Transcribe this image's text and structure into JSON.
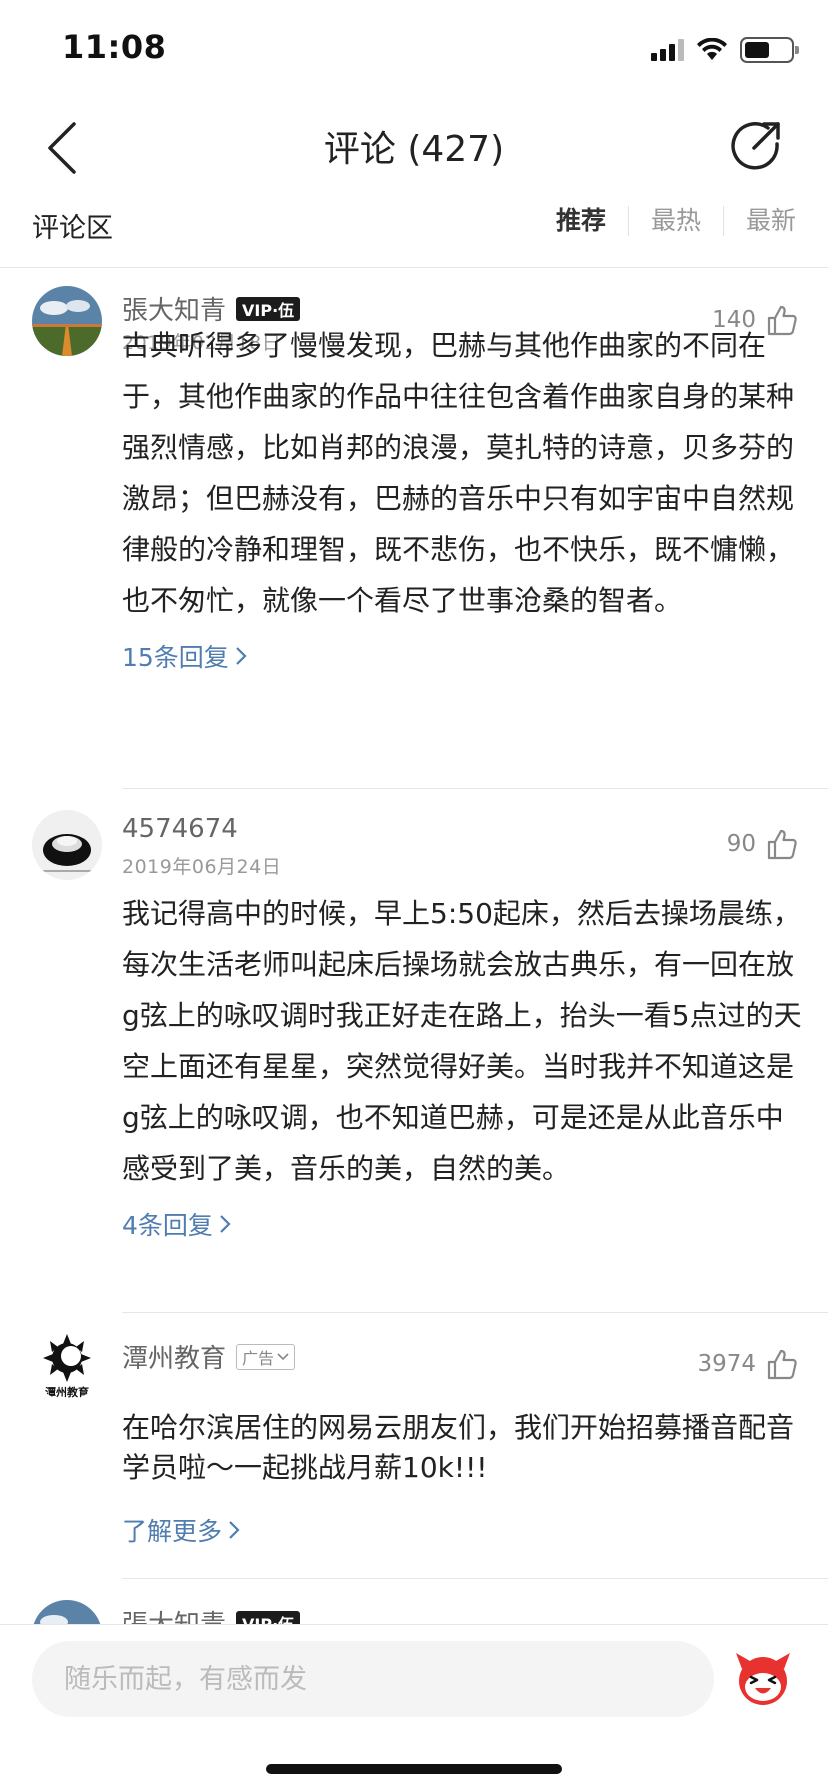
{
  "status_bar": {
    "time": "11:08"
  },
  "nav": {
    "title": "评论 (427)"
  },
  "section": {
    "title": "评论区",
    "sort_tabs": [
      {
        "label": "推荐",
        "active": true
      },
      {
        "label": "最热",
        "active": false
      },
      {
        "label": "最新",
        "active": false
      }
    ]
  },
  "comments": [
    {
      "username": "張大知青",
      "badge": "VIP·伍",
      "date": "2019年02月18日",
      "likes": "140",
      "content": "古典听得多了慢慢发现，巴赫与其他作曲家的不同在于，其他作曲家的作品中往往包含着作曲家自身的某种强烈情感，比如肖邦的浪漫，莫扎特的诗意，贝多芬的激昂；但巴赫没有，巴赫的音乐中只有如宇宙中自然规律般的冷静和理智，既不悲伤，也不快乐，既不慵懒，也不匆忙，就像一个看尽了世事沧桑的智者。",
      "replies": "15条回复"
    },
    {
      "username": "4574674",
      "date": "2019年06月24日",
      "likes": "90",
      "content": "我记得高中的时候，早上5:50起床，然后去操场晨练，每次生活老师叫起床后操场就会放古典乐，有一回在放g弦上的咏叹调时我正好走在路上，抬头一看5点过的天空上面还有星星，突然觉得好美。当时我并不知道这是g弦上的咏叹调，也不知道巴赫，可是还是从此音乐中感受到了美，音乐的美，自然的美。",
      "replies": "4条回复"
    },
    {
      "username": "潭州教育",
      "ad_label": "广告",
      "likes": "3974",
      "content": "在哈尔滨居住的网易云朋友们，我们开始招募播音配音学员啦～一起挑战月薪10k!!!",
      "replies": "了解更多",
      "avatar_text": "潭州教育"
    },
    {
      "username": "張大知青",
      "badge": "VIP·伍"
    }
  ],
  "input": {
    "placeholder": "随乐而起，有感而发"
  },
  "colors": {
    "link": "#507daf",
    "vip_bg": "#1c1c1c",
    "input_bg": "#f4f4f4"
  }
}
